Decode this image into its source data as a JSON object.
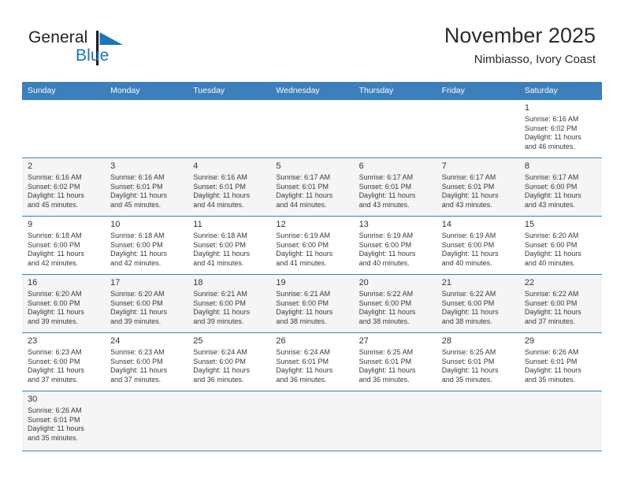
{
  "brand": {
    "name_part1": "General",
    "name_part2": "Blue",
    "flag_icon": "blue-triangle-flag-icon",
    "color_black": "#231f20",
    "color_blue": "#1b75bb"
  },
  "header": {
    "title": "November 2025",
    "subtitle": "Nimbiasso, Ivory Coast"
  },
  "theme": {
    "header_row_bg": "#3d7ebd",
    "header_row_text": "#ffffff",
    "row_alt_bg": "#f5f5f5",
    "grid_line": "#3d7ebd"
  },
  "weekday_headers": [
    "Sunday",
    "Monday",
    "Tuesday",
    "Wednesday",
    "Thursday",
    "Friday",
    "Saturday"
  ],
  "labels": {
    "sunrise_prefix": "Sunrise:",
    "sunset_prefix": "Sunset:",
    "daylight_prefix": "Daylight:"
  },
  "weeks": [
    [
      {
        "empty": true
      },
      {
        "empty": true
      },
      {
        "empty": true
      },
      {
        "empty": true
      },
      {
        "empty": true
      },
      {
        "empty": true
      },
      {
        "day": "1",
        "sunrise": "Sunrise: 6:16 AM",
        "sunset": "Sunset: 6:02 PM",
        "daylight1": "Daylight: 11 hours",
        "daylight2": "and 46 minutes."
      }
    ],
    [
      {
        "day": "2",
        "sunrise": "Sunrise: 6:16 AM",
        "sunset": "Sunset: 6:02 PM",
        "daylight1": "Daylight: 11 hours",
        "daylight2": "and 45 minutes."
      },
      {
        "day": "3",
        "sunrise": "Sunrise: 6:16 AM",
        "sunset": "Sunset: 6:01 PM",
        "daylight1": "Daylight: 11 hours",
        "daylight2": "and 45 minutes."
      },
      {
        "day": "4",
        "sunrise": "Sunrise: 6:16 AM",
        "sunset": "Sunset: 6:01 PM",
        "daylight1": "Daylight: 11 hours",
        "daylight2": "and 44 minutes."
      },
      {
        "day": "5",
        "sunrise": "Sunrise: 6:17 AM",
        "sunset": "Sunset: 6:01 PM",
        "daylight1": "Daylight: 11 hours",
        "daylight2": "and 44 minutes."
      },
      {
        "day": "6",
        "sunrise": "Sunrise: 6:17 AM",
        "sunset": "Sunset: 6:01 PM",
        "daylight1": "Daylight: 11 hours",
        "daylight2": "and 43 minutes."
      },
      {
        "day": "7",
        "sunrise": "Sunrise: 6:17 AM",
        "sunset": "Sunset: 6:01 PM",
        "daylight1": "Daylight: 11 hours",
        "daylight2": "and 43 minutes."
      },
      {
        "day": "8",
        "sunrise": "Sunrise: 6:17 AM",
        "sunset": "Sunset: 6:00 PM",
        "daylight1": "Daylight: 11 hours",
        "daylight2": "and 43 minutes."
      }
    ],
    [
      {
        "day": "9",
        "sunrise": "Sunrise: 6:18 AM",
        "sunset": "Sunset: 6:00 PM",
        "daylight1": "Daylight: 11 hours",
        "daylight2": "and 42 minutes."
      },
      {
        "day": "10",
        "sunrise": "Sunrise: 6:18 AM",
        "sunset": "Sunset: 6:00 PM",
        "daylight1": "Daylight: 11 hours",
        "daylight2": "and 42 minutes."
      },
      {
        "day": "11",
        "sunrise": "Sunrise: 6:18 AM",
        "sunset": "Sunset: 6:00 PM",
        "daylight1": "Daylight: 11 hours",
        "daylight2": "and 41 minutes."
      },
      {
        "day": "12",
        "sunrise": "Sunrise: 6:19 AM",
        "sunset": "Sunset: 6:00 PM",
        "daylight1": "Daylight: 11 hours",
        "daylight2": "and 41 minutes."
      },
      {
        "day": "13",
        "sunrise": "Sunrise: 6:19 AM",
        "sunset": "Sunset: 6:00 PM",
        "daylight1": "Daylight: 11 hours",
        "daylight2": "and 40 minutes."
      },
      {
        "day": "14",
        "sunrise": "Sunrise: 6:19 AM",
        "sunset": "Sunset: 6:00 PM",
        "daylight1": "Daylight: 11 hours",
        "daylight2": "and 40 minutes."
      },
      {
        "day": "15",
        "sunrise": "Sunrise: 6:20 AM",
        "sunset": "Sunset: 6:00 PM",
        "daylight1": "Daylight: 11 hours",
        "daylight2": "and 40 minutes."
      }
    ],
    [
      {
        "day": "16",
        "sunrise": "Sunrise: 6:20 AM",
        "sunset": "Sunset: 6:00 PM",
        "daylight1": "Daylight: 11 hours",
        "daylight2": "and 39 minutes."
      },
      {
        "day": "17",
        "sunrise": "Sunrise: 6:20 AM",
        "sunset": "Sunset: 6:00 PM",
        "daylight1": "Daylight: 11 hours",
        "daylight2": "and 39 minutes."
      },
      {
        "day": "18",
        "sunrise": "Sunrise: 6:21 AM",
        "sunset": "Sunset: 6:00 PM",
        "daylight1": "Daylight: 11 hours",
        "daylight2": "and 39 minutes."
      },
      {
        "day": "19",
        "sunrise": "Sunrise: 6:21 AM",
        "sunset": "Sunset: 6:00 PM",
        "daylight1": "Daylight: 11 hours",
        "daylight2": "and 38 minutes."
      },
      {
        "day": "20",
        "sunrise": "Sunrise: 6:22 AM",
        "sunset": "Sunset: 6:00 PM",
        "daylight1": "Daylight: 11 hours",
        "daylight2": "and 38 minutes."
      },
      {
        "day": "21",
        "sunrise": "Sunrise: 6:22 AM",
        "sunset": "Sunset: 6:00 PM",
        "daylight1": "Daylight: 11 hours",
        "daylight2": "and 38 minutes."
      },
      {
        "day": "22",
        "sunrise": "Sunrise: 6:22 AM",
        "sunset": "Sunset: 6:00 PM",
        "daylight1": "Daylight: 11 hours",
        "daylight2": "and 37 minutes."
      }
    ],
    [
      {
        "day": "23",
        "sunrise": "Sunrise: 6:23 AM",
        "sunset": "Sunset: 6:00 PM",
        "daylight1": "Daylight: 11 hours",
        "daylight2": "and 37 minutes."
      },
      {
        "day": "24",
        "sunrise": "Sunrise: 6:23 AM",
        "sunset": "Sunset: 6:00 PM",
        "daylight1": "Daylight: 11 hours",
        "daylight2": "and 37 minutes."
      },
      {
        "day": "25",
        "sunrise": "Sunrise: 6:24 AM",
        "sunset": "Sunset: 6:00 PM",
        "daylight1": "Daylight: 11 hours",
        "daylight2": "and 36 minutes."
      },
      {
        "day": "26",
        "sunrise": "Sunrise: 6:24 AM",
        "sunset": "Sunset: 6:01 PM",
        "daylight1": "Daylight: 11 hours",
        "daylight2": "and 36 minutes."
      },
      {
        "day": "27",
        "sunrise": "Sunrise: 6:25 AM",
        "sunset": "Sunset: 6:01 PM",
        "daylight1": "Daylight: 11 hours",
        "daylight2": "and 36 minutes."
      },
      {
        "day": "28",
        "sunrise": "Sunrise: 6:25 AM",
        "sunset": "Sunset: 6:01 PM",
        "daylight1": "Daylight: 11 hours",
        "daylight2": "and 35 minutes."
      },
      {
        "day": "29",
        "sunrise": "Sunrise: 6:26 AM",
        "sunset": "Sunset: 6:01 PM",
        "daylight1": "Daylight: 11 hours",
        "daylight2": "and 35 minutes."
      }
    ],
    [
      {
        "day": "30",
        "sunrise": "Sunrise: 6:26 AM",
        "sunset": "Sunset: 6:01 PM",
        "daylight1": "Daylight: 11 hours",
        "daylight2": "and 35 minutes."
      },
      {
        "empty": true
      },
      {
        "empty": true
      },
      {
        "empty": true
      },
      {
        "empty": true
      },
      {
        "empty": true
      },
      {
        "empty": true
      }
    ]
  ]
}
